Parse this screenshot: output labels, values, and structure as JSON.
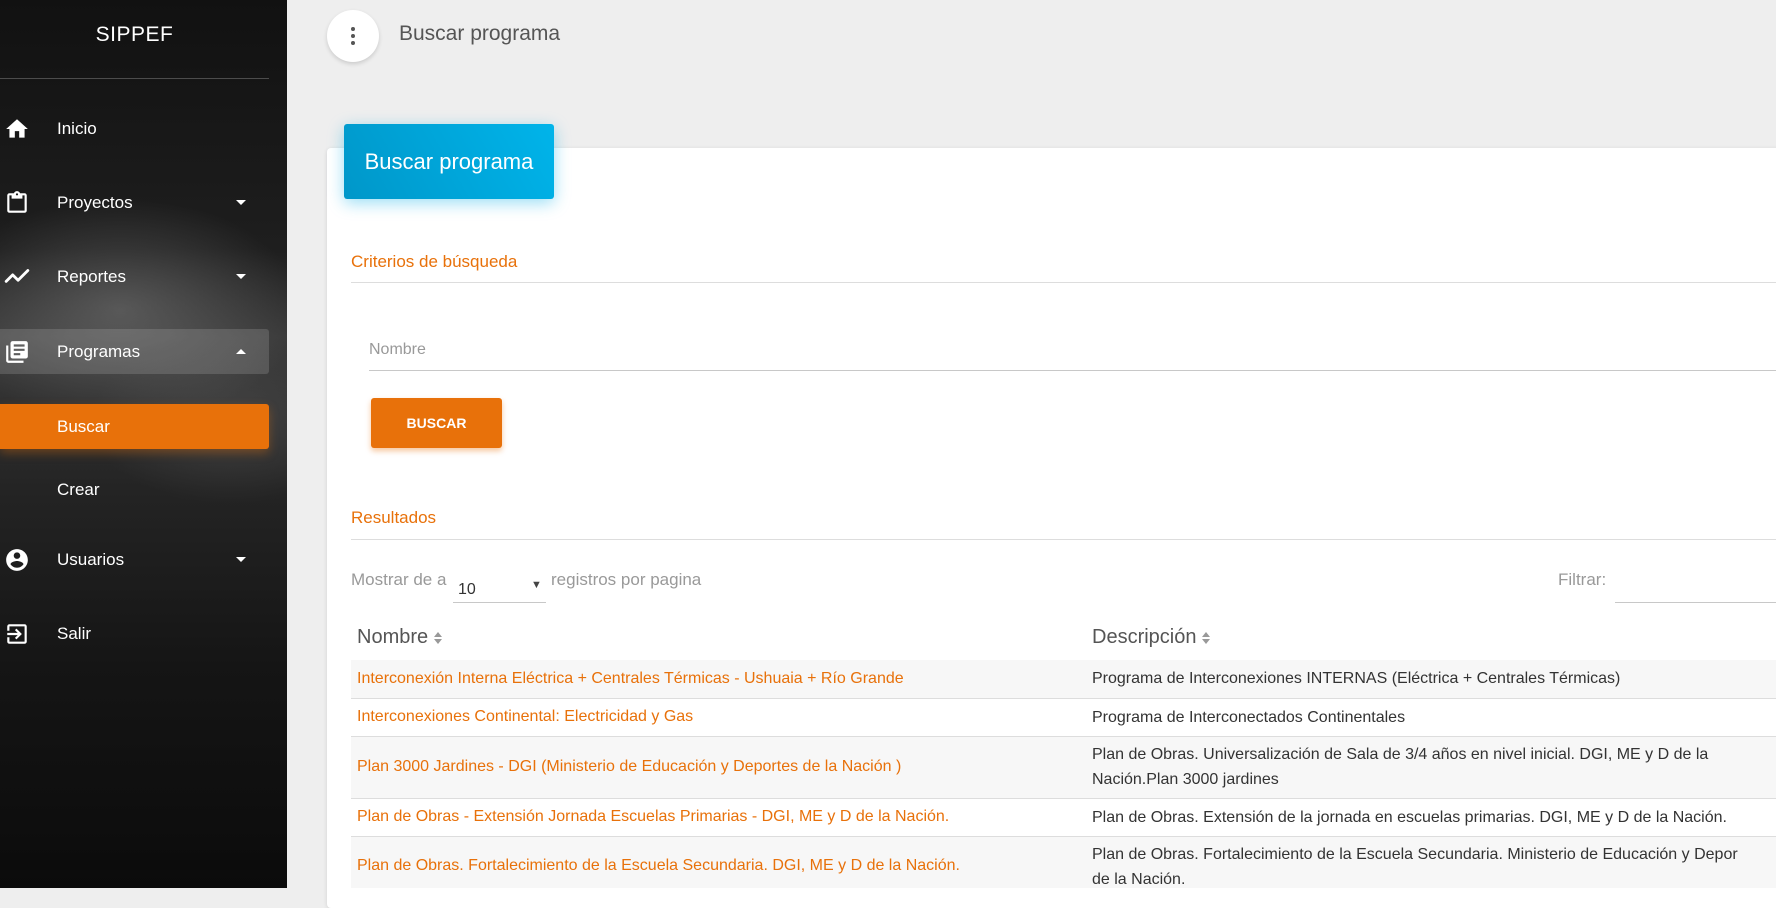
{
  "sidebar": {
    "brand": "SIPPEF",
    "items": [
      {
        "label": "Inicio",
        "icon": "home-icon"
      },
      {
        "label": "Proyectos",
        "icon": "clipboard-icon"
      },
      {
        "label": "Reportes",
        "icon": "trending-icon"
      },
      {
        "label": "Programas",
        "icon": "library-icon"
      },
      {
        "label": "Buscar"
      },
      {
        "label": "Crear"
      },
      {
        "label": "Usuarios",
        "icon": "account-circle-icon"
      },
      {
        "label": "Salir",
        "icon": "exit-icon"
      }
    ],
    "active_color": "#e8710a"
  },
  "topbar": {
    "title": "Buscar programa",
    "menu_icon": "more-vertical-icon"
  },
  "card": {
    "header": "Buscar programa",
    "criteria_title": "Criterios de búsqueda",
    "name_placeholder": "Nombre",
    "search_button": "BUSCAR",
    "results_title": "Resultados",
    "show_prefix": "Mostrar de a",
    "page_length": "10",
    "show_suffix": "registros por pagina",
    "filter_label": "Filtrar:"
  },
  "table": {
    "headers": [
      "Nombre",
      "Descripción"
    ],
    "rows": [
      {
        "nombre": "Interconexión Interna Eléctrica + Centrales Térmicas - Ushuaia + Río Grande",
        "desc1": "Programa de Interconexiones INTERNAS (Eléctrica + Centrales Térmicas)",
        "desc2": ""
      },
      {
        "nombre": "Interconexiones Continental: Electricidad y Gas",
        "desc1": "Programa de Interconectados Continentales",
        "desc2": ""
      },
      {
        "nombre": "Plan 3000 Jardines - DGI (Ministerio de Educación y Deportes de la Nación )",
        "desc1": "Plan de Obras. Universalización de Sala de 3/4 años en nivel inicial. DGI, ME y D de la",
        "desc2": "Nación.Plan 3000 jardines"
      },
      {
        "nombre": "Plan de Obras - Extensión Jornada Escuelas Primarias - DGI, ME y D de la Nación.",
        "desc1": "Plan de Obras. Extensión de la jornada en escuelas primarias. DGI, ME y D de la Nación.",
        "desc2": ""
      },
      {
        "nombre": "Plan de Obras. Fortalecimiento de la Escuela Secundaria. DGI, ME y D de la Nación.",
        "desc1": "Plan de Obras. Fortalecimiento de la Escuela Secundaria. Ministerio de Educación y Depor",
        "desc2": "de la Nación."
      }
    ]
  }
}
